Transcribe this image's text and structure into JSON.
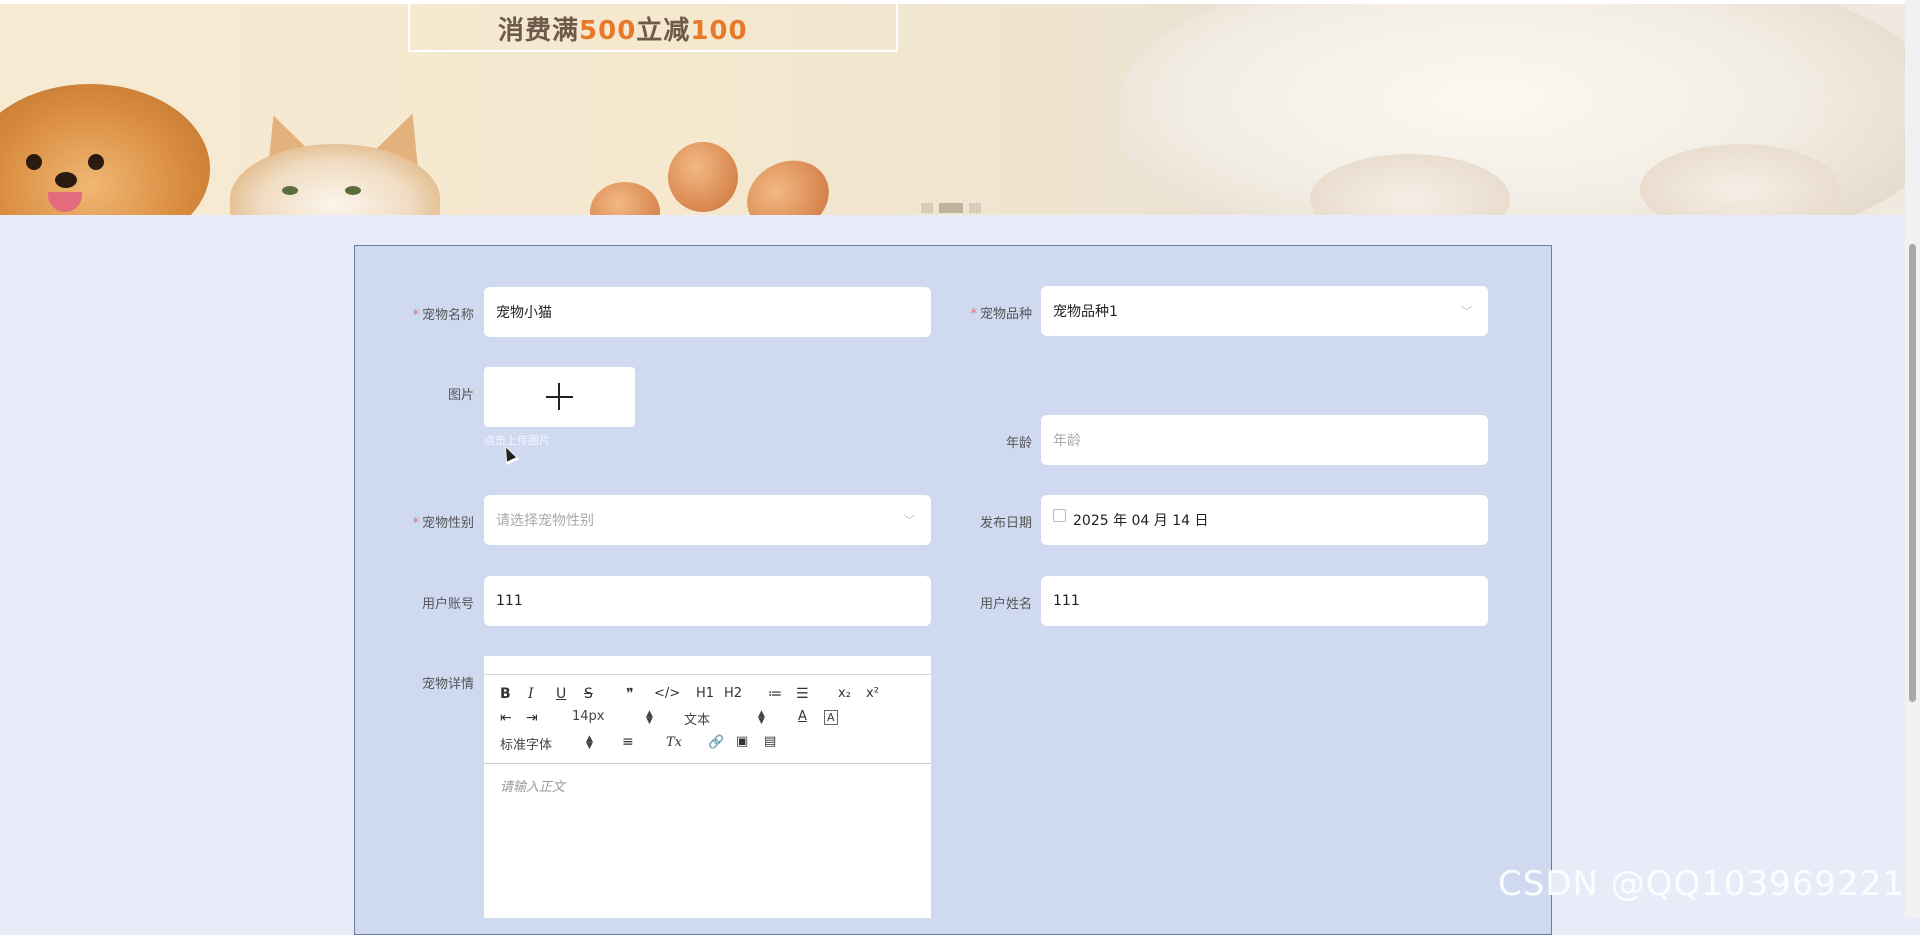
{
  "banner": {
    "promo_prefix": "消费满",
    "promo_amount": "500",
    "promo_mid": "立减",
    "promo_discount": "100",
    "carousel_active_index": 1,
    "carousel_count": 3
  },
  "form": {
    "pet_name": {
      "label": "宠物名称",
      "value": "宠物小猫",
      "required": true
    },
    "pet_breed": {
      "label": "宠物品种",
      "value": "宠物品种1",
      "required": true
    },
    "image": {
      "label": "图片",
      "upload_hint": "点击上传图片"
    },
    "age": {
      "label": "年龄",
      "placeholder": "年龄"
    },
    "pet_gender": {
      "label": "宠物性别",
      "placeholder": "请选择宠物性别",
      "required": true
    },
    "publish_date": {
      "label": "发布日期",
      "value": "2025 年 04 月 14 日"
    },
    "user_account": {
      "label": "用户账号",
      "value": "111"
    },
    "user_name": {
      "label": "用户姓名",
      "value": "111"
    },
    "pet_detail": {
      "label": "宠物详情",
      "placeholder": "请输入正文"
    }
  },
  "editor": {
    "bold": "B",
    "italic": "I",
    "underline": "U",
    "strike": "S",
    "quote": "❞",
    "code": "</>",
    "h1": "H1",
    "h2": "H2",
    "ordered_list": "≔",
    "bullet_list": "☰",
    "subscript": "x₂",
    "superscript": "x²",
    "indent_minus": "⇤",
    "indent_plus": "⇥",
    "size_value": "14px",
    "header_value": "文本",
    "font_color": "A",
    "bg_color": "A",
    "font_family_value": "标准字体",
    "align": "≡",
    "clean": "Tx",
    "link": "🔗",
    "image": "▣",
    "video": "▤"
  },
  "watermark": "CSDN @QQ1039692211"
}
